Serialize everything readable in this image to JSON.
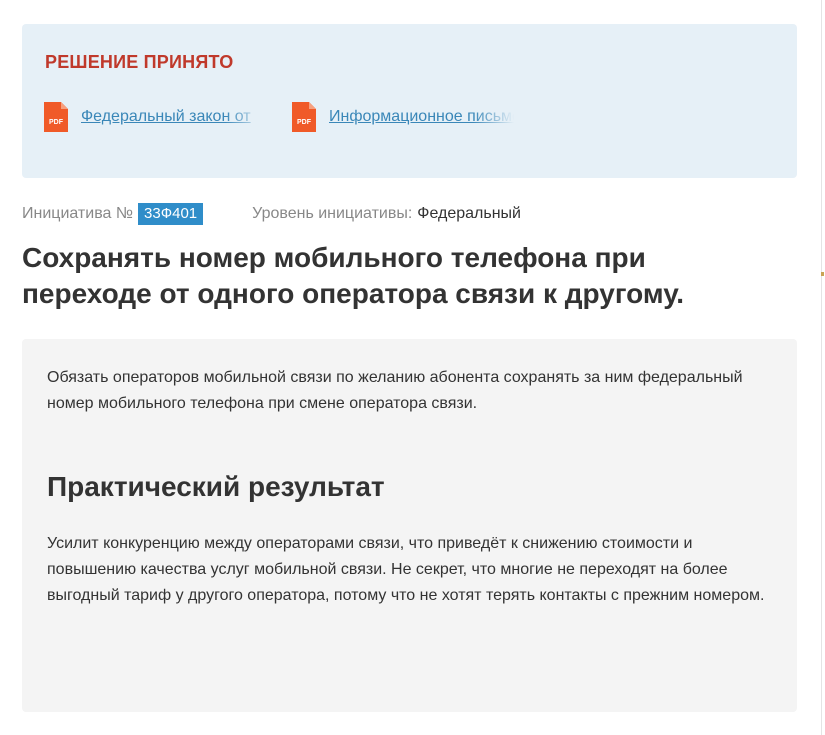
{
  "decision": {
    "title": "РЕШЕНИЕ ПРИНЯТО",
    "documents": [
      {
        "icon": "pdf-file-icon",
        "icon_label": "PDF",
        "label": "Федеральный закон от"
      },
      {
        "icon": "pdf-file-icon",
        "icon_label": "PDF",
        "label": "Информационное письмо"
      }
    ]
  },
  "meta": {
    "initiative_label": "Инициатива №",
    "initiative_number": "33Ф401",
    "level_label": "Уровень инициативы:",
    "level_value": "Федеральный"
  },
  "title": "Сохранять номер мобильного телефона при переходе от одного оператора связи к другому.",
  "content": {
    "description": "Обязать операторов мобильной связи по желанию абонента сохранять за ним федеральный номер мобильного телефона при смене оператора связи.",
    "result_heading": "Практический результат",
    "result_text": "Усилит конкуренцию между операторами связи, что приведёт к снижению стоимости и повышению качества услуг мобильной связи. Не секрет, что многие не переходят на более выгодный тариф у другого оператора, потому что не хотят терять контакты с прежним номером."
  },
  "colors": {
    "decision_title": "#c0392b",
    "link": "#3a87b8",
    "badge": "#2f8dc9",
    "pdf_icon": "#f05a28",
    "decision_bg": "#e6f0f7",
    "content_bg": "#f4f4f4"
  }
}
